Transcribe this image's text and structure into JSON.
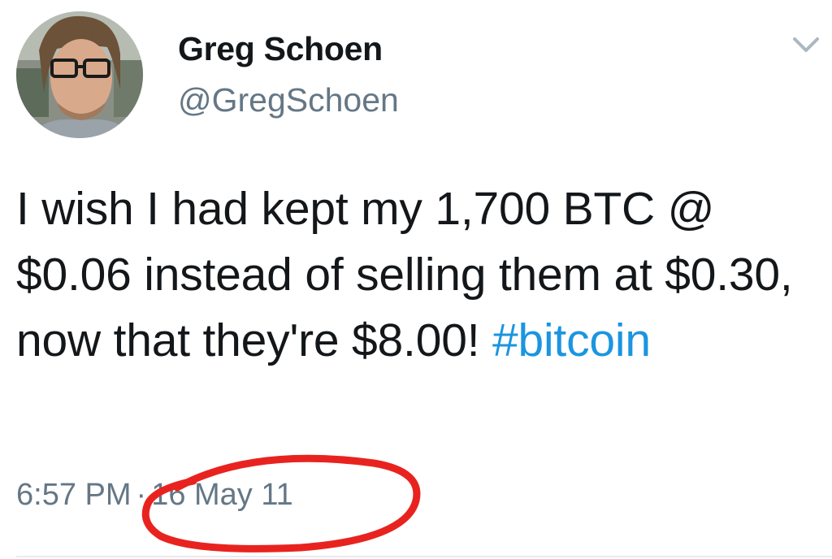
{
  "author": {
    "name": "Greg Schoen",
    "handle": "@GregSchoen",
    "avatar_icon": "profile-photo"
  },
  "tweet": {
    "text_before_hashtag": "I wish I had kept my 1,700 BTC @ $0.06 instead of selling them at $0.30, now that they're $8.00!",
    "hashtag": "#bitcoin",
    "time": "6:57 PM",
    "separator": "·",
    "date": "16 May 11"
  },
  "colors": {
    "hashtag": "#1b95e0",
    "name": "#14171a",
    "secondary": "#657786",
    "annotation": "#e8231f"
  },
  "icons": {
    "menu": "chevron-down-icon"
  }
}
